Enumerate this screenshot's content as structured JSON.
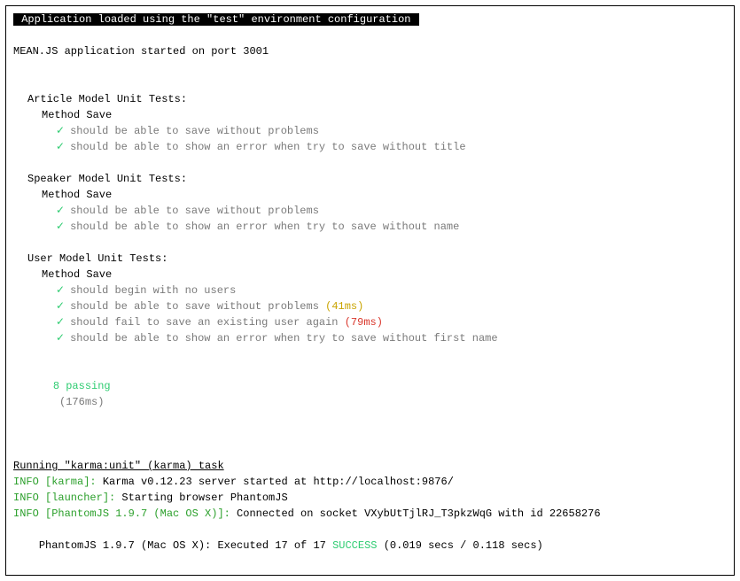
{
  "header": {
    "env_line": " Application loaded using the \"test\" environment configuration "
  },
  "startup": {
    "port_line": "MEAN.JS application started on port 3001"
  },
  "suites": [
    {
      "title": "Article Model Unit Tests:",
      "method": "Method Save",
      "tests": [
        {
          "text": "should be able to save without problems",
          "timing": null,
          "timing_color": null
        },
        {
          "text": "should be able to show an error when try to save without title",
          "timing": null,
          "timing_color": null
        }
      ]
    },
    {
      "title": "Speaker Model Unit Tests:",
      "method": "Method Save",
      "tests": [
        {
          "text": "should be able to save without problems",
          "timing": null,
          "timing_color": null
        },
        {
          "text": "should be able to show an error when try to save without name",
          "timing": null,
          "timing_color": null
        }
      ]
    },
    {
      "title": "User Model Unit Tests:",
      "method": "Method Save",
      "tests": [
        {
          "text": "should begin with no users",
          "timing": null,
          "timing_color": null
        },
        {
          "text": "should be able to save without problems",
          "timing": "(41ms)",
          "timing_color": "yellow"
        },
        {
          "text": "should fail to save an existing user again",
          "timing": "(79ms)",
          "timing_color": "red"
        },
        {
          "text": "should be able to show an error when try to save without first name",
          "timing": null,
          "timing_color": null
        }
      ]
    }
  ],
  "summary": {
    "passing": "8 passing",
    "duration": "(176ms)"
  },
  "karma": {
    "task_line": "Running \"karma:unit\" (karma) task",
    "lines": [
      {
        "prefix": "INFO [karma]: ",
        "text": "Karma v0.12.23 server started at http://localhost:9876/"
      },
      {
        "prefix": "INFO [launcher]: ",
        "text": "Starting browser PhantomJS"
      },
      {
        "prefix": "INFO [PhantomJS 1.9.7 (Mac OS X)]: ",
        "text": "Connected on socket VXybUtTjlRJ_T3pkzWqG with id 22658276"
      }
    ],
    "result": {
      "prefix": "PhantomJS 1.9.7 (Mac OS X): Executed 17 of 17 ",
      "status": "SUCCESS",
      "suffix": " (0.019 secs / 0.118 secs)"
    }
  }
}
